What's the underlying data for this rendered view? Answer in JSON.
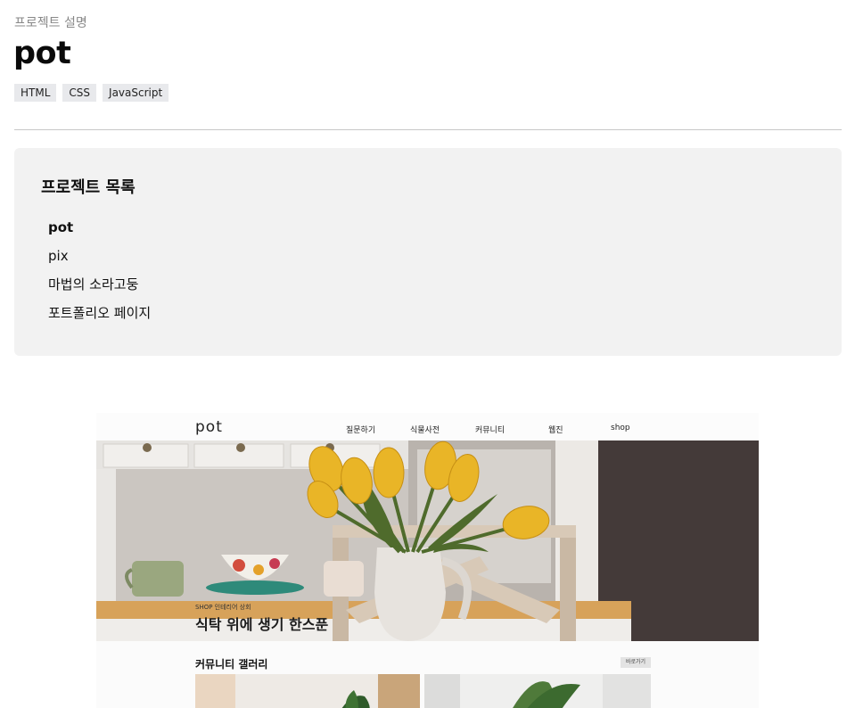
{
  "page": {
    "eyebrow": "프로젝트 설명",
    "title": "pot",
    "tags": [
      "HTML",
      "CSS",
      "JavaScript"
    ]
  },
  "toc": {
    "title": "프로젝트 목록",
    "items": [
      {
        "label": "pot",
        "active": true
      },
      {
        "label": "pix",
        "active": false
      },
      {
        "label": "마법의 소라고둥",
        "active": false
      },
      {
        "label": "포트폴리오 페이지",
        "active": false
      }
    ]
  },
  "preview": {
    "logo": "pot",
    "nav": [
      "질문하기",
      "식물사전",
      "커뮤니티",
      "웹진",
      "shop"
    ],
    "hero_caption": "SHOP 인테리어 상회",
    "hero_title": "식탁 위에 생기 한스푼",
    "gallery_title": "커뮤니티 갤러리",
    "more_label": "바로가기"
  },
  "colors": {
    "tag_bg": "#e8e9ec",
    "panel_bg": "#f2f2f2",
    "tulip": "#e9b527"
  }
}
